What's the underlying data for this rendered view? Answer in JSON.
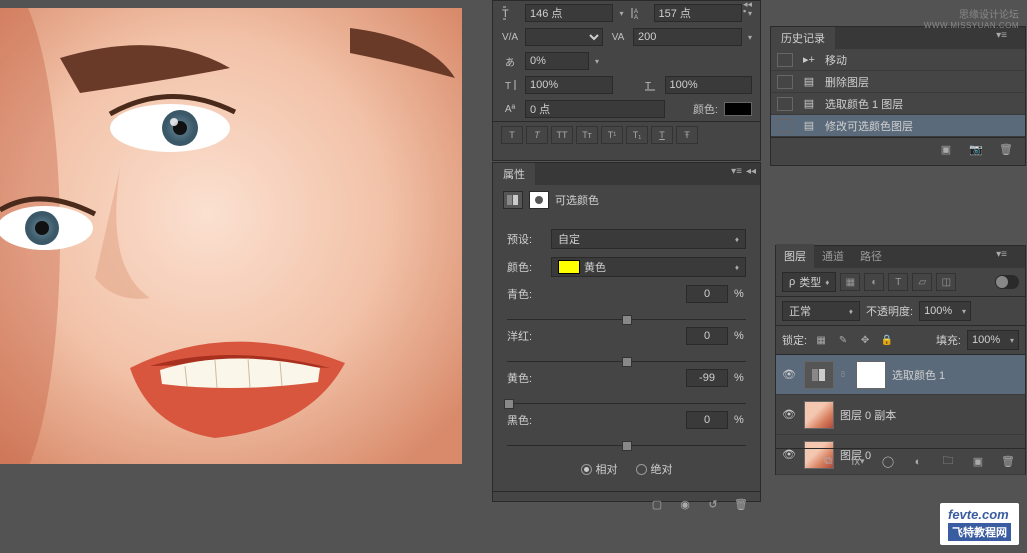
{
  "watermark_top_line1": "思缘设计论坛",
  "watermark_top_line2": "WWW.MISSYUAN.COM",
  "watermark_bottom_main": "fevte.com",
  "watermark_bottom_sub": "飞特教程网",
  "character": {
    "font_size": "146 点",
    "leading": "157 点",
    "tracking": "200",
    "baseline_shift": "0%",
    "vscale": "100%",
    "hscale": "100%",
    "baseline": "0 点",
    "color_label": "颜色:"
  },
  "history": {
    "title": "历史记录",
    "items": [
      {
        "icon": "move",
        "label": "移动"
      },
      {
        "icon": "doc",
        "label": "删除图层"
      },
      {
        "icon": "doc",
        "label": "选取颜色 1 图层"
      },
      {
        "icon": "doc",
        "label": "修改可选颜色图层",
        "selected": true
      }
    ]
  },
  "properties": {
    "title": "属性",
    "adj_name": "可选颜色",
    "preset_label": "预设:",
    "preset_value": "自定",
    "colors_label": "颜色:",
    "colors_value": "黄色",
    "cyan_label": "青色:",
    "cyan_value": "0",
    "magenta_label": "洋红:",
    "magenta_value": "0",
    "yellow_label": "黄色:",
    "yellow_value": "-99",
    "black_label": "黑色:",
    "black_value": "0",
    "pct": "%",
    "relative": "相对",
    "absolute": "绝对"
  },
  "layers": {
    "tab_layers": "图层",
    "tab_channels": "通道",
    "tab_paths": "路径",
    "kind_icon": "ρ",
    "kind": "类型",
    "blend": "正常",
    "opacity_label": "不透明度:",
    "opacity": "100%",
    "lock_label": "锁定:",
    "fill_label": "填充:",
    "fill": "100%",
    "items": [
      {
        "name": "选取颜色 1",
        "type": "adjustment",
        "selected": true
      },
      {
        "name": "图层 0 副本",
        "type": "pixel"
      },
      {
        "name": "图层 0",
        "type": "pixel"
      }
    ]
  }
}
